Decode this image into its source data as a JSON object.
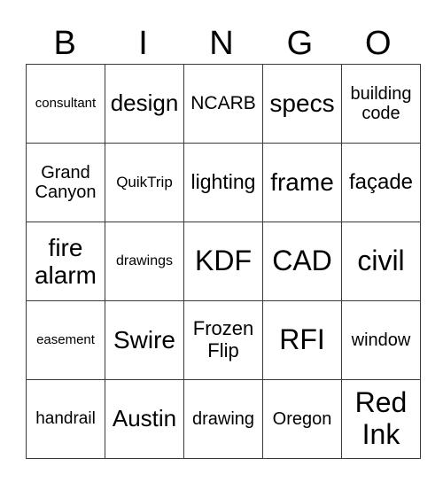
{
  "header": [
    "B",
    "I",
    "N",
    "G",
    "O"
  ],
  "cells": [
    [
      {
        "t": "consultant",
        "s": 15
      },
      {
        "t": "design",
        "s": 26
      },
      {
        "t": "NCARB",
        "s": 21
      },
      {
        "t": "specs",
        "s": 28
      },
      {
        "t": "building code",
        "s": 20
      }
    ],
    [
      {
        "t": "Grand Canyon",
        "s": 20
      },
      {
        "t": "QuikTrip",
        "s": 17
      },
      {
        "t": "lighting",
        "s": 23
      },
      {
        "t": "frame",
        "s": 28
      },
      {
        "t": "façade",
        "s": 24
      }
    ],
    [
      {
        "t": "fire alarm",
        "s": 28
      },
      {
        "t": "drawings",
        "s": 16
      },
      {
        "t": "KDF",
        "s": 32
      },
      {
        "t": "CAD",
        "s": 32
      },
      {
        "t": "civil",
        "s": 32
      }
    ],
    [
      {
        "t": "easement",
        "s": 15
      },
      {
        "t": "Swire",
        "s": 28
      },
      {
        "t": "Frozen Flip",
        "s": 22
      },
      {
        "t": "RFI",
        "s": 32
      },
      {
        "t": "window",
        "s": 20
      }
    ],
    [
      {
        "t": "handrail",
        "s": 19
      },
      {
        "t": "Austin",
        "s": 26
      },
      {
        "t": "drawing",
        "s": 20
      },
      {
        "t": "Oregon",
        "s": 20
      },
      {
        "t": "Red Ink",
        "s": 32
      }
    ]
  ]
}
